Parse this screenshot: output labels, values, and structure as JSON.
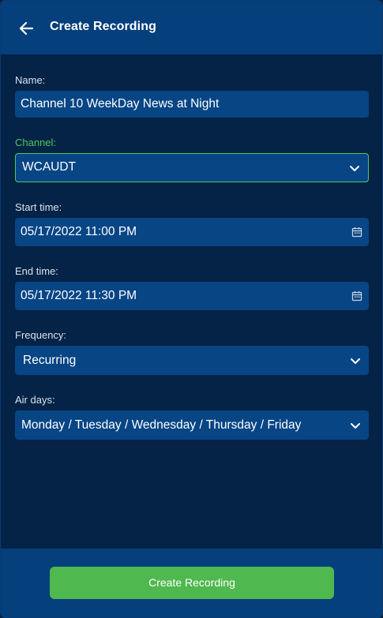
{
  "header": {
    "title": "Create Recording",
    "back_icon": "arrow-left-icon"
  },
  "form": {
    "name": {
      "label": "Name:",
      "value": "Channel 10 WeekDay News at Night"
    },
    "channel": {
      "label": "Channel:",
      "value": "WCAUDT",
      "icon": "chevron-down-icon"
    },
    "start_time": {
      "label": "Start time:",
      "value": "05/17/2022 11:00 PM",
      "icon": "calendar-icon"
    },
    "end_time": {
      "label": "End time:",
      "value": "05/17/2022 11:30 PM",
      "icon": "calendar-icon"
    },
    "frequency": {
      "label": "Frequency:",
      "value": "Recurring",
      "icon": "chevron-down-icon"
    },
    "air_days": {
      "label": "Air days:",
      "value": "Monday / Tuesday / Wednesday / Thursday / Friday",
      "icon": "chevron-down-icon"
    }
  },
  "footer": {
    "create_label": "Create Recording"
  },
  "colors": {
    "background": "#042346",
    "header": "#053f7c",
    "field": "#074585",
    "accent_green": "#4cc95a",
    "button_green": "#4fb84f"
  }
}
